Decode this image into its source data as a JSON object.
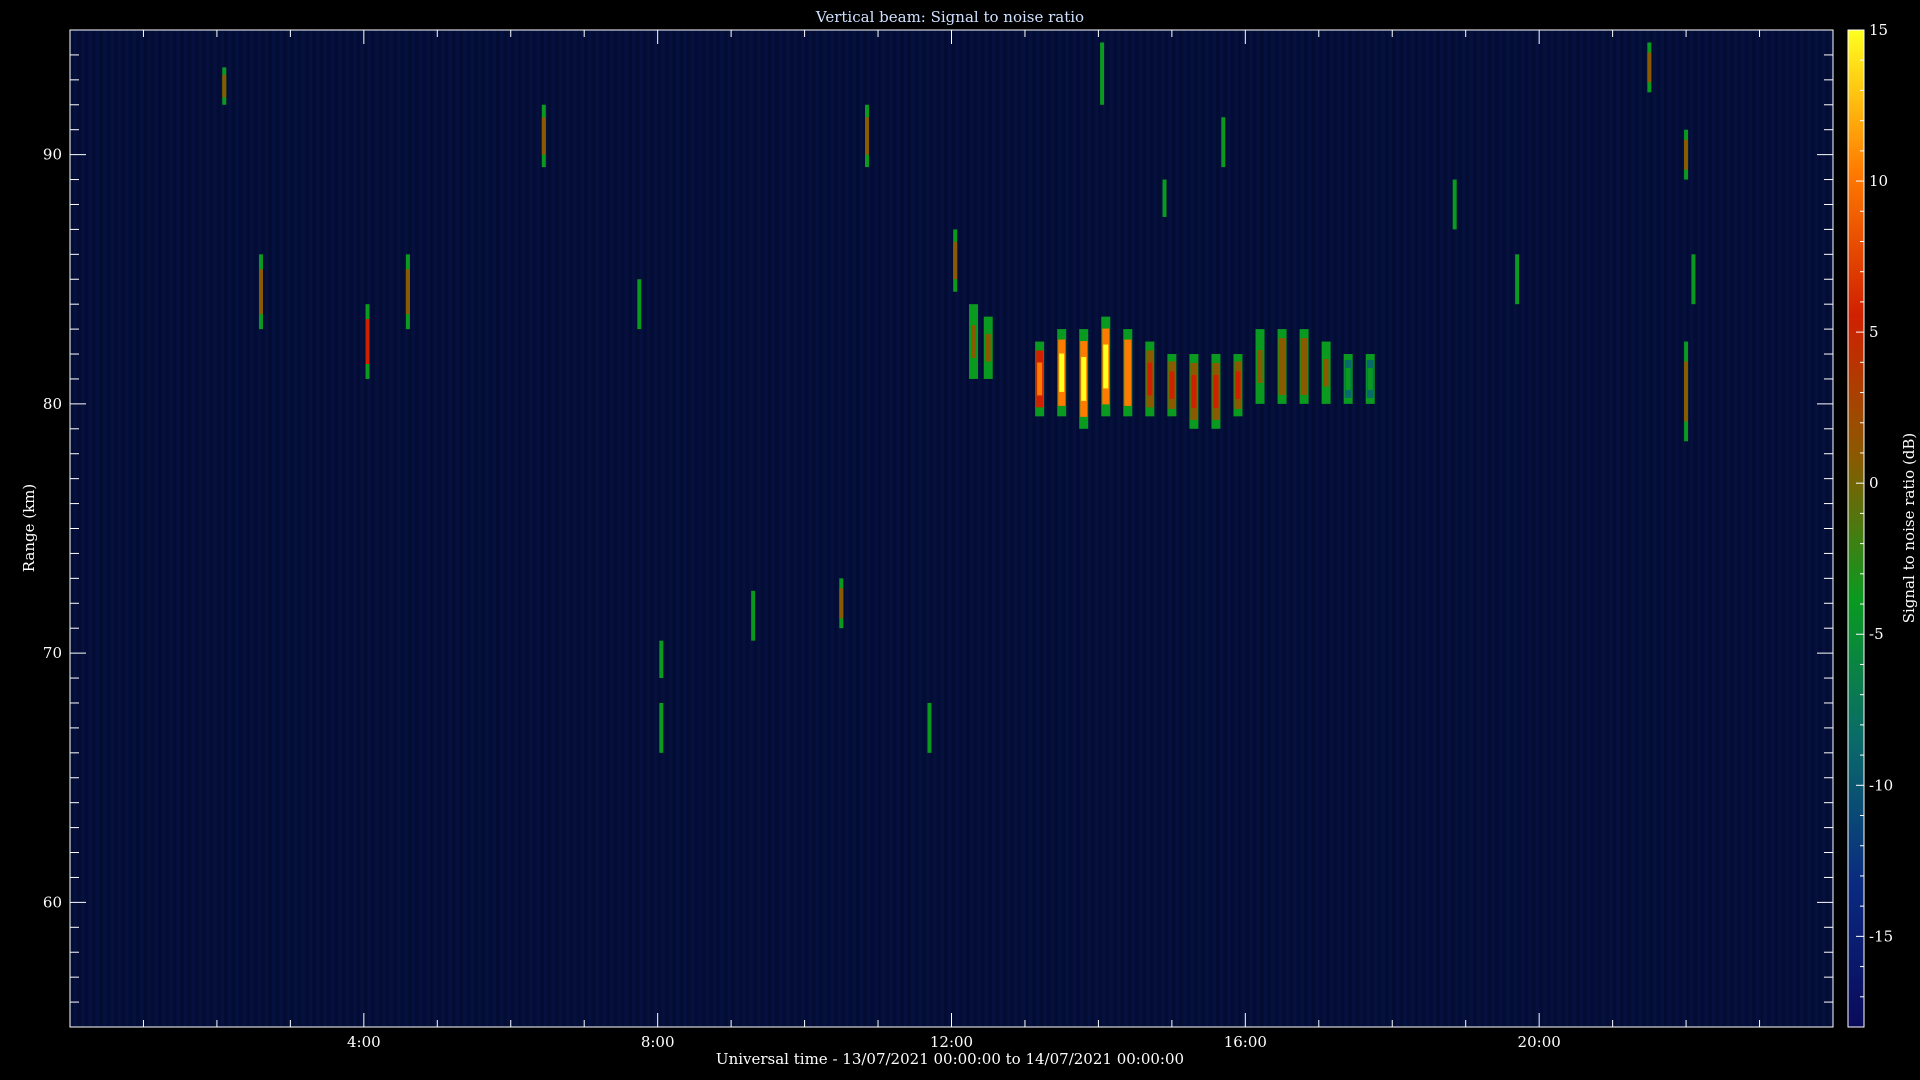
{
  "chart_data": {
    "type": "heatmap",
    "title": "Vertical beam: Signal to noise ratio",
    "xlabel": "Universal time - 13/07/2021 00:00:00 to 14/07/2021 00:00:00",
    "ylabel": "Range (km)",
    "x_unit": "hours UT",
    "xlim": [
      0,
      24
    ],
    "ylim": [
      55,
      95
    ],
    "x_ticks": [
      "4:00",
      "8:00",
      "12:00",
      "16:00",
      "20:00"
    ],
    "x_tick_values": [
      4,
      8,
      12,
      16,
      20
    ],
    "y_ticks": [
      "60",
      "70",
      "80",
      "90"
    ],
    "y_tick_values": [
      60,
      70,
      80,
      90
    ],
    "colorbar": {
      "label": "Signal to noise ratio (dB)",
      "range": [
        -18,
        15
      ],
      "ticks": [
        "15",
        "10",
        "5",
        "0",
        "-5",
        "-10",
        "-15"
      ],
      "tick_values": [
        15,
        10,
        5,
        0,
        -5,
        -10,
        -15
      ],
      "colors": [
        "#0a0a5a",
        "#0a2a80",
        "#0a6a6a",
        "#0a9a20",
        "#8a5a00",
        "#d02000",
        "#ff7a00",
        "#ffff20"
      ]
    },
    "background_snr_db": -15,
    "echo_layer": [
      {
        "time": 12.3,
        "range_low": 81,
        "range_high": 84,
        "snr_db": 2
      },
      {
        "time": 12.5,
        "range_low": 81,
        "range_high": 83.5,
        "snr_db": 0
      },
      {
        "time": 13.2,
        "range_low": 79.5,
        "range_high": 82.5,
        "snr_db": 8
      },
      {
        "time": 13.5,
        "range_low": 79.5,
        "range_high": 83,
        "snr_db": 13
      },
      {
        "time": 13.8,
        "range_low": 79,
        "range_high": 83,
        "snr_db": 15
      },
      {
        "time": 14.1,
        "range_low": 79.5,
        "range_high": 83.5,
        "snr_db": 14
      },
      {
        "time": 14.4,
        "range_low": 79.5,
        "range_high": 83,
        "snr_db": 12
      },
      {
        "time": 14.7,
        "range_low": 79.5,
        "range_high": 82.5,
        "snr_db": 7
      },
      {
        "time": 15.0,
        "range_low": 79.5,
        "range_high": 82,
        "snr_db": 5
      },
      {
        "time": 15.3,
        "range_low": 79,
        "range_high": 82,
        "snr_db": 4
      },
      {
        "time": 15.6,
        "range_low": 79,
        "range_high": 82,
        "snr_db": 5
      },
      {
        "time": 15.9,
        "range_low": 79.5,
        "range_high": 82,
        "snr_db": 4
      },
      {
        "time": 16.2,
        "range_low": 80,
        "range_high": 83,
        "snr_db": 2
      },
      {
        "time": 16.5,
        "range_low": 80,
        "range_high": 83,
        "snr_db": 3
      },
      {
        "time": 16.8,
        "range_low": 80,
        "range_high": 83,
        "snr_db": 3
      },
      {
        "time": 17.1,
        "range_low": 80,
        "range_high": 82.5,
        "snr_db": 0
      },
      {
        "time": 17.4,
        "range_low": 80,
        "range_high": 82,
        "snr_db": -3
      },
      {
        "time": 17.7,
        "range_low": 80,
        "range_high": 82,
        "snr_db": -5
      }
    ],
    "sporadic_echoes": [
      {
        "time": 2.1,
        "range_low": 92,
        "range_high": 93.5,
        "snr_db": 1
      },
      {
        "time": 2.6,
        "range_low": 83,
        "range_high": 86,
        "snr_db": 3
      },
      {
        "time": 4.05,
        "range_low": 81,
        "range_high": 84,
        "snr_db": 4
      },
      {
        "time": 4.6,
        "range_low": 83,
        "range_high": 86,
        "snr_db": 2
      },
      {
        "time": 6.45,
        "range_low": 89.5,
        "range_high": 92,
        "snr_db": 1
      },
      {
        "time": 10.5,
        "range_low": 71,
        "range_high": 73,
        "snr_db": 2
      },
      {
        "time": 10.85,
        "range_low": 89.5,
        "range_high": 92,
        "snr_db": 2
      },
      {
        "time": 12.05,
        "range_low": 84.5,
        "range_high": 87,
        "snr_db": 1
      },
      {
        "time": 21.5,
        "range_low": 92.5,
        "range_high": 94.5,
        "snr_db": 1
      },
      {
        "time": 22.0,
        "range_low": 89,
        "range_high": 91,
        "snr_db": 1
      },
      {
        "time": 22.0,
        "range_low": 78.5,
        "range_high": 82.5,
        "snr_db": 2
      },
      {
        "time": 7.75,
        "range_low": 83,
        "range_high": 85,
        "snr_db": -6
      },
      {
        "time": 8.05,
        "range_low": 66,
        "range_high": 68,
        "snr_db": -7
      },
      {
        "time": 8.05,
        "range_low": 69,
        "range_high": 70.5,
        "snr_db": -8
      },
      {
        "time": 9.3,
        "range_low": 70.5,
        "range_high": 72.5,
        "snr_db": -7
      },
      {
        "time": 11.7,
        "range_low": 66,
        "range_high": 68,
        "snr_db": -7
      },
      {
        "time": 14.05,
        "range_low": 92,
        "range_high": 94.5,
        "snr_db": -7
      },
      {
        "time": 14.9,
        "range_low": 87.5,
        "range_high": 89,
        "snr_db": -8
      },
      {
        "time": 15.7,
        "range_low": 89.5,
        "range_high": 91.5,
        "snr_db": -8
      },
      {
        "time": 18.85,
        "range_low": 87,
        "range_high": 89,
        "snr_db": -7
      },
      {
        "time": 19.7,
        "range_low": 84,
        "range_high": 86,
        "snr_db": -8
      },
      {
        "time": 22.1,
        "range_low": 84,
        "range_high": 86,
        "snr_db": -7
      }
    ]
  }
}
